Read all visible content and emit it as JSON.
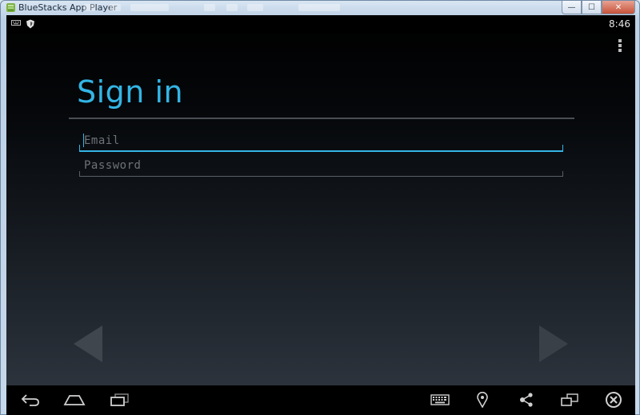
{
  "window": {
    "title": "BlueStacks App Player",
    "minimize_glyph": "—",
    "maximize_glyph": "☐",
    "close_glyph": "✕"
  },
  "statusbar": {
    "time": "8:46",
    "icons": [
      "keyboard-notification-icon",
      "bluestacks-shield-icon"
    ]
  },
  "signin": {
    "heading": "Sign in",
    "email_placeholder": "Email",
    "password_placeholder": "Password"
  },
  "navbar": {
    "icons": [
      "back-icon",
      "home-icon",
      "recent-apps-icon",
      "keyboard-icon",
      "location-icon",
      "share-icon",
      "screen-rotate-icon",
      "close-app-icon"
    ]
  },
  "colors": {
    "accent": "#33b5e5",
    "screen_top": "#000000",
    "screen_bottom": "#2c333c",
    "hint_text": "#6e7378"
  }
}
